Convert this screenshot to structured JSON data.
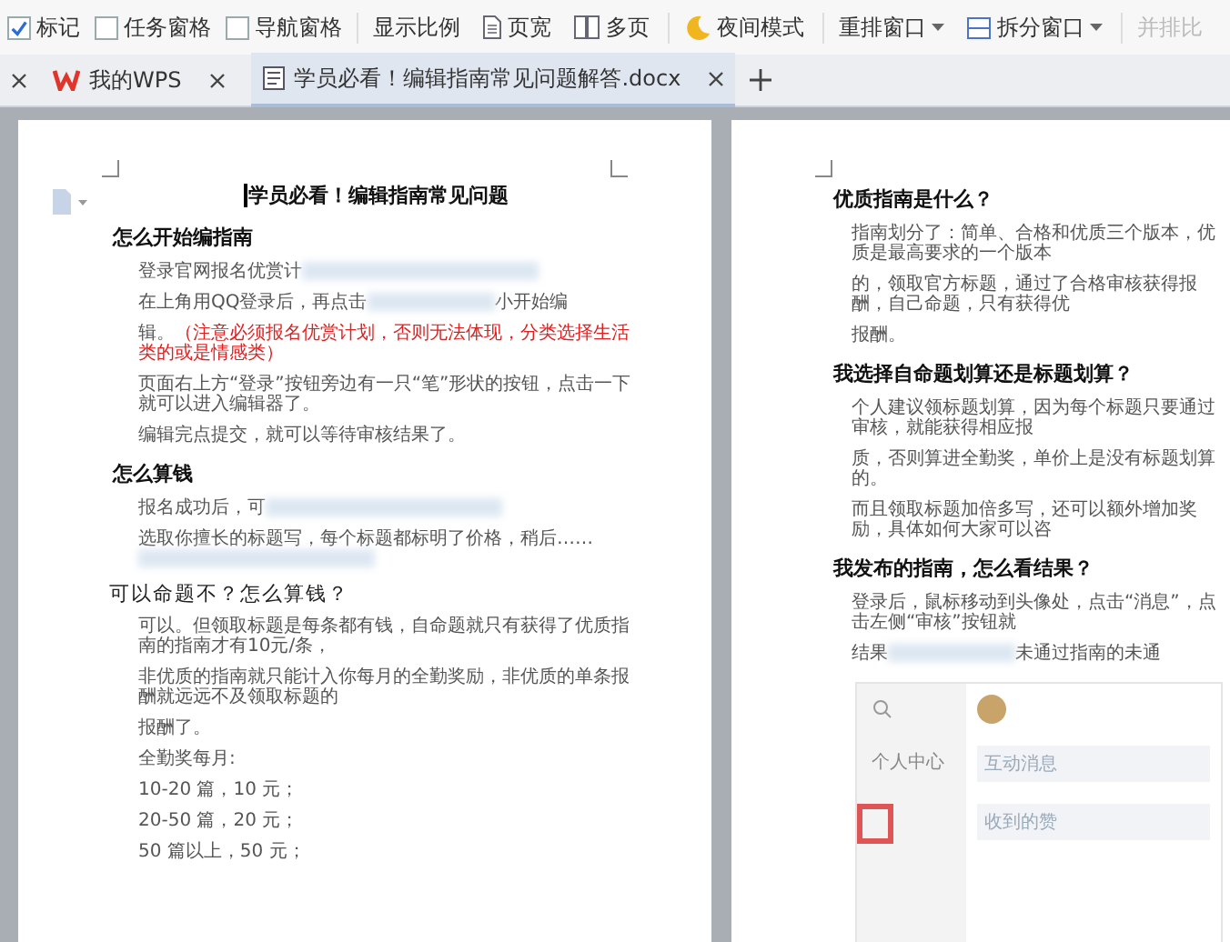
{
  "toolbar": [
    {
      "kind": "checkbox",
      "label": "标记",
      "checked": true
    },
    {
      "kind": "checkbox",
      "label": "任务窗格",
      "checked": false
    },
    {
      "kind": "checkbox",
      "label": "导航窗格",
      "checked": false
    },
    {
      "kind": "plain",
      "label": "显示比例",
      "dropdown": false,
      "disabled": false
    },
    {
      "kind": "page",
      "label": "页宽",
      "dropdown": false,
      "disabled": false
    },
    {
      "kind": "pages",
      "label": "多页",
      "dropdown": false,
      "disabled": false
    },
    {
      "kind": "moon",
      "label": "夜间模式",
      "dropdown": false,
      "disabled": false
    },
    {
      "kind": "plain",
      "label": "重排窗口",
      "dropdown": true,
      "disabled": false
    },
    {
      "kind": "split",
      "label": "拆分窗口",
      "dropdown": true,
      "disabled": false
    },
    {
      "kind": "plain",
      "label": "并排比",
      "dropdown": false,
      "disabled": true
    }
  ],
  "tabs": [
    {
      "kind": "home",
      "label": "我的WPS",
      "selected": false
    },
    {
      "kind": "doc",
      "label": "学员必看！编辑指南常见问题解答.docx",
      "selected": true
    }
  ],
  "pages": [
    {
      "title": "学员必看！编辑指南常见问题",
      "paragraphs": [
        {
          "kind": "heading",
          "text": "怎么开始编指南"
        },
        {
          "kind": "text",
          "text": "登录官网报名优赏计",
          "blurred": true
        },
        {
          "kind": "text",
          "text": "在上角用QQ登录后，再点击",
          "blurred": true,
          "after": "小开始编"
        },
        {
          "kind": "text",
          "text": "辑。",
          "note": "（注意必须报名优赏计划，否则无法体现，分类选择生活类的或是情感类）"
        },
        {
          "kind": "text",
          "text": "页面右上方“登录”按钮旁边有一只“笔”形状的按钮，点击一下就可以进入编辑器了。"
        },
        {
          "kind": "text",
          "text": "编辑完点提交，就可以等待审核结果了。"
        },
        {
          "kind": "heading",
          "text": "怎么算钱"
        },
        {
          "kind": "text",
          "text": "报名成功后，可",
          "blurred": true
        },
        {
          "kind": "text",
          "text": "选取你擅长的标题写，每个标题都标明了价格，稍后……",
          "blurred": true
        },
        {
          "kind": "subheading",
          "text": "可以命题不？怎么算钱？"
        },
        {
          "kind": "text",
          "text": "可以。但领取标题是每条都有钱，自命题就只有获得了优质指南的指南才有10元/条，"
        },
        {
          "kind": "text",
          "text": "非优质的指南就只能计入你每月的全勤奖励，非优质的单条报酬就远远不及领取标题的"
        },
        {
          "kind": "text",
          "text": "报酬了。"
        },
        {
          "kind": "text",
          "text": "全勤奖每月:"
        },
        {
          "kind": "text",
          "text": "10-20 篇，10 元；"
        },
        {
          "kind": "text",
          "text": "20-50 篇，20 元；"
        },
        {
          "kind": "text",
          "text": "50 篇以上，50 元；"
        }
      ]
    },
    {
      "paragraphs": [
        {
          "kind": "heading",
          "text": "优质指南是什么？"
        },
        {
          "kind": "text",
          "text": "指南划分了：简单、合格和优质三个版本，优质是最高要求的一个版本"
        },
        {
          "kind": "text",
          "text": "的，领取官方标题，通过了合格审核获得报酬，自己命题，只有获得优"
        },
        {
          "kind": "text",
          "text": "报酬。"
        },
        {
          "kind": "heading",
          "text": "我选择自命题划算还是标题划算？"
        },
        {
          "kind": "text",
          "text": "个人建议领标题划算，因为每个标题只要通过审核，就能获得相应报"
        },
        {
          "kind": "text",
          "text": "质，否则算进全勤奖，单价上是没有标题划算的。"
        },
        {
          "kind": "text",
          "text": "而且领取标题加倍多写，还可以额外增加奖励，具体如何大家可以咨"
        },
        {
          "kind": "heading",
          "text": "我发布的指南，怎么看结果？"
        },
        {
          "kind": "text",
          "text": "登录后，鼠标移动到头像处，点击“消息”，点击左侧“审核”按钮就"
        },
        {
          "kind": "text",
          "text": "结果",
          "blurred": true,
          "after": "未通过指南的未通"
        }
      ],
      "screenshot": {
        "items": [
          "互动消息",
          "收到的赞"
        ],
        "side": "个人中心"
      }
    }
  ]
}
